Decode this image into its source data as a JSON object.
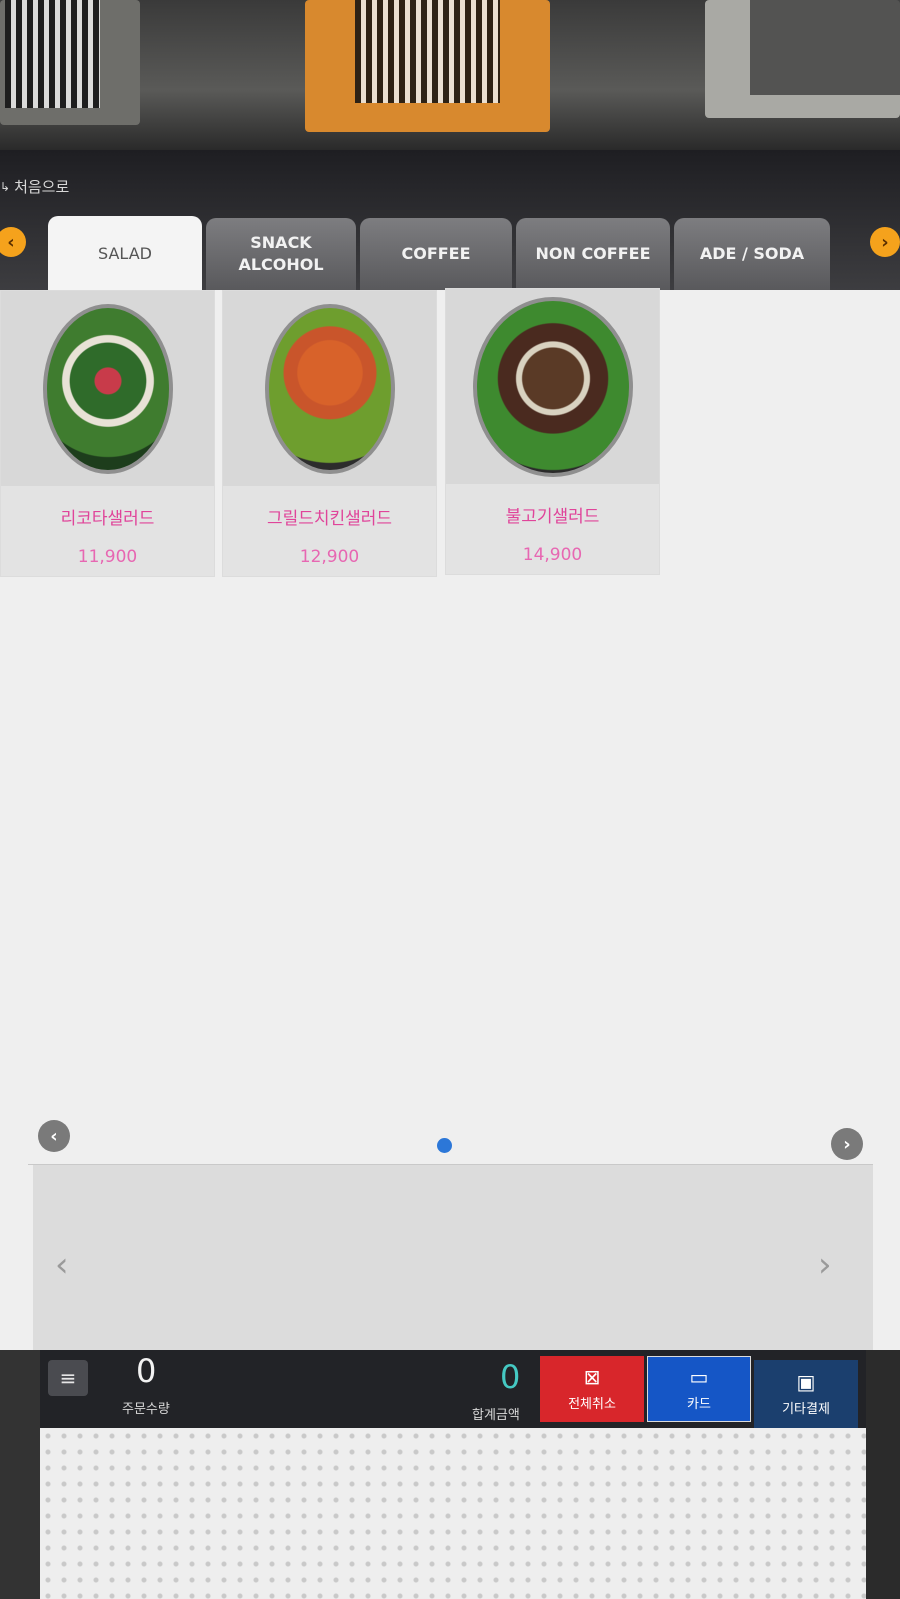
{
  "header": {
    "home_label": "처음으로",
    "tabs": [
      {
        "label": "SALAD",
        "active": true
      },
      {
        "label": "SNACK\nALCOHOL",
        "active": false
      },
      {
        "label": "COFFEE",
        "active": false
      },
      {
        "label": "NON COFFEE",
        "active": false
      },
      {
        "label": "ADE / SODA",
        "active": false
      }
    ]
  },
  "products": [
    {
      "name": "리코타샐러드",
      "price": "11,900"
    },
    {
      "name": "그릴드치킨샐러드",
      "price": "12,900"
    },
    {
      "name": "불고기샐러드",
      "price": "14,900"
    }
  ],
  "bottom": {
    "qty_value": "0",
    "qty_label": "주문수량",
    "total_value": "0",
    "total_label": "합계금액",
    "cancel_label": "전체취소",
    "card_label": "카드",
    "other_label": "기타결제"
  },
  "colors": {
    "accent_orange": "#f5a21c",
    "price_pink": "#e0449a",
    "cancel_red": "#d8262b",
    "card_blue": "#1556c6",
    "total_teal": "#45c9c3"
  }
}
